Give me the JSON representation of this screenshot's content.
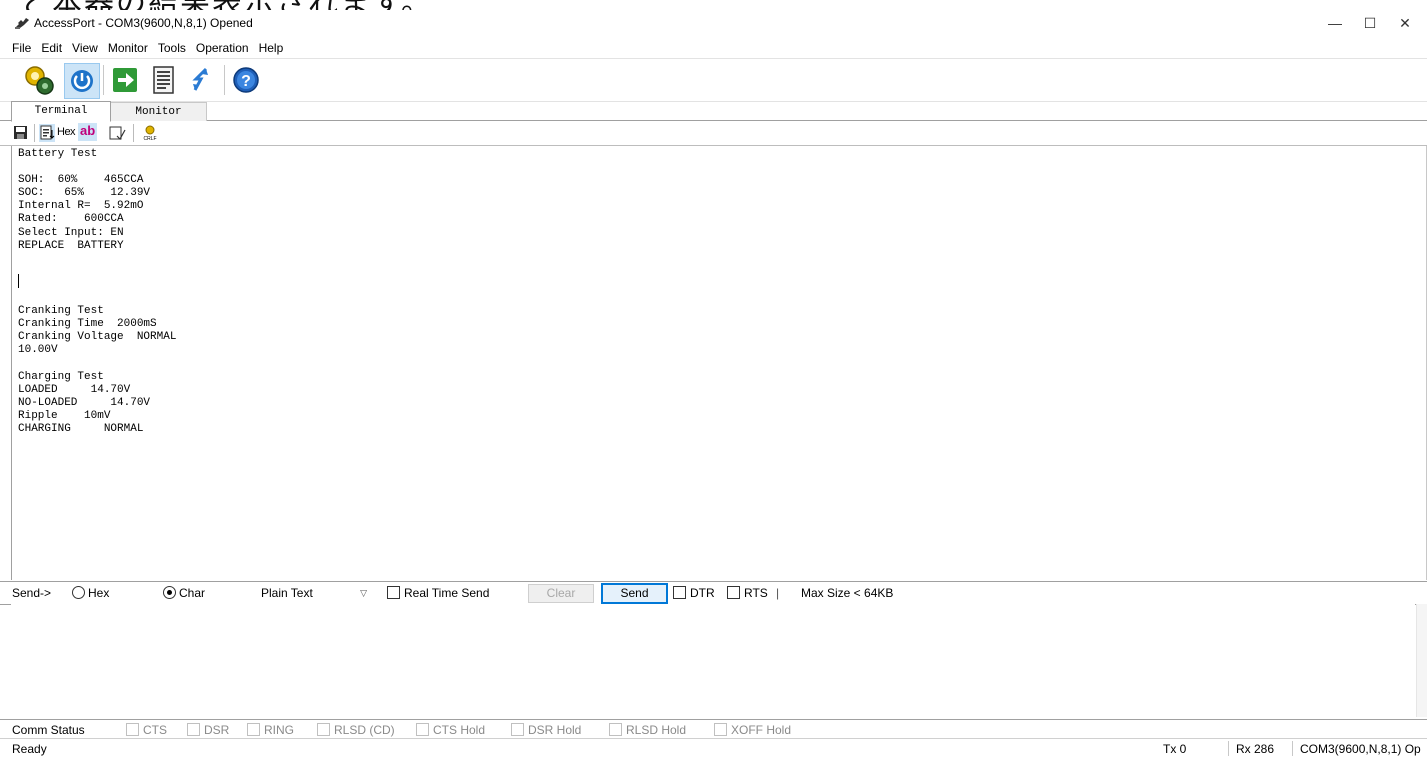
{
  "overlay_caption": "と本器の結果表示されます。",
  "window": {
    "title": "AccessPort - COM3(9600,N,8,1) Opened",
    "minimize_glyph": "—",
    "maximize_glyph": "☐",
    "close_glyph": "✕"
  },
  "menu": [
    "File",
    "Edit",
    "View",
    "Monitor",
    "Tools",
    "Operation",
    "Help"
  ],
  "toolbar": {
    "icons": [
      "settings-icon",
      "power-icon",
      "run-icon",
      "document-icon",
      "refresh-icon",
      "help-icon"
    ]
  },
  "tabs": [
    {
      "label": "Terminal",
      "active": true
    },
    {
      "label": "Monitor",
      "active": false
    }
  ],
  "terminal_toolbar": {
    "hex_label": "Hex",
    "ab_label": "ab",
    "crlf_label": "CRLF"
  },
  "terminal": {
    "lines": [
      "Battery Test",
      "",
      "SOH:  60%    465CCA",
      "SOC:   65%    12.39V",
      "Internal R=  5.92mO",
      "Rated:    600CCA",
      "Select Input: EN",
      "REPLACE  BATTERY",
      "",
      "",
      "",
      "",
      "Cranking Test",
      "Cranking Time  2000mS",
      "Cranking Voltage  NORMAL",
      "10.00V",
      "",
      "Charging Test",
      "LOADED     14.70V",
      "NO-LOADED     14.70V",
      "Ripple    10mV",
      "CHARGING     NORMAL"
    ]
  },
  "sendbar": {
    "label": "Send->",
    "hex_option": "Hex",
    "char_option": "Char",
    "selected_mode": "Char",
    "format_value": "Plain Text",
    "realtime_label": "Real Time Send",
    "clear_label": "Clear",
    "send_label": "Send",
    "dtr_label": "DTR",
    "rts_label": "RTS",
    "divider_glyph": "|",
    "max_size_label": "Max Size < 64KB"
  },
  "comm_status": {
    "label": "Comm Status",
    "items": [
      "CTS",
      "DSR",
      "RING",
      "RLSD (CD)",
      "CTS Hold",
      "DSR Hold",
      "RLSD Hold",
      "XOFF Hold"
    ]
  },
  "statusbar": {
    "ready": "Ready",
    "tx": "Tx 0",
    "rx": "Rx 286",
    "port": "COM3(9600,N,8,1) Op"
  }
}
